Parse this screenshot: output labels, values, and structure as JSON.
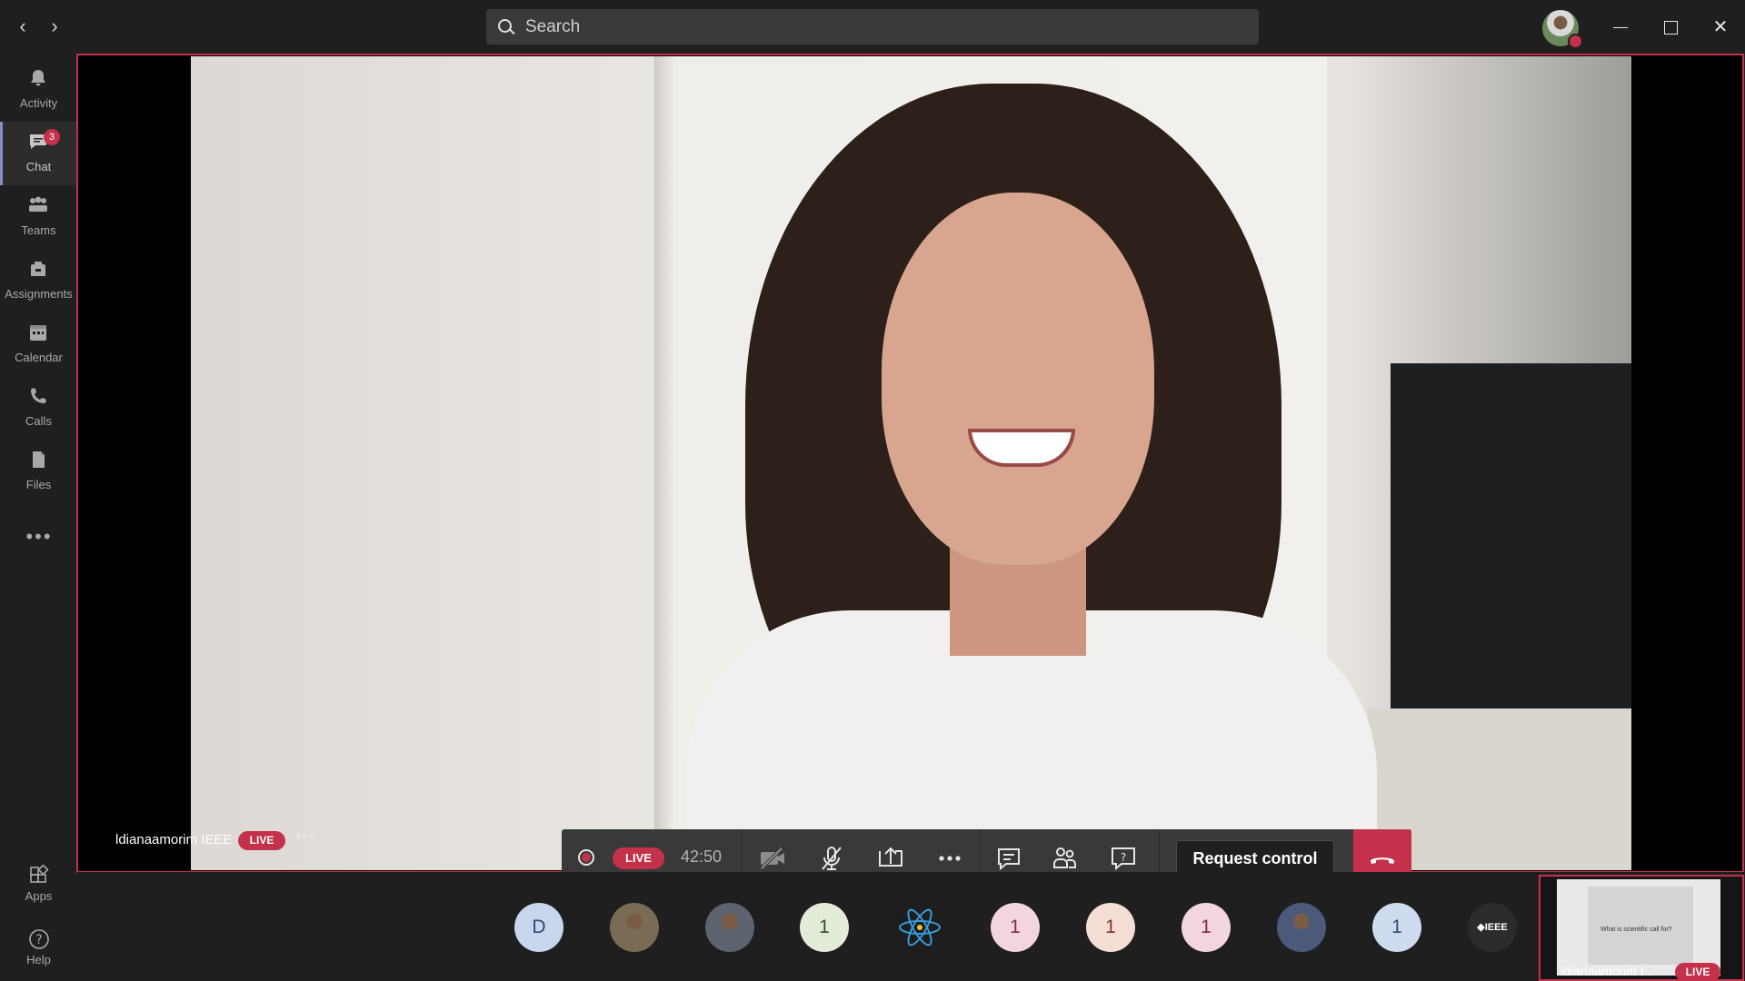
{
  "search": {
    "placeholder": "Search"
  },
  "rail": {
    "items": [
      {
        "label": "Activity",
        "icon": "bell-icon"
      },
      {
        "label": "Chat",
        "icon": "chat-icon",
        "badge": "3",
        "active": true
      },
      {
        "label": "Teams",
        "icon": "teams-icon"
      },
      {
        "label": "Assignments",
        "icon": "backpack-icon"
      },
      {
        "label": "Calendar",
        "icon": "calendar-icon"
      },
      {
        "label": "Calls",
        "icon": "phone-icon"
      },
      {
        "label": "Files",
        "icon": "file-icon"
      }
    ],
    "more": "•••",
    "apps": "Apps",
    "help": "Help"
  },
  "meeting": {
    "presenter_name": "ldianaamorim IEEE",
    "live_label": "LIVE",
    "presenter_more": "•••",
    "timer": "42:50",
    "request_control": "Request control"
  },
  "participants": [
    {
      "initial": "D",
      "bg": "#c7d6ec",
      "fg": "#2f4a78"
    },
    {
      "initial": "",
      "bg": "#7a6b55",
      "fg": "#fff",
      "photo": true
    },
    {
      "initial": "",
      "bg": "#5d6470",
      "fg": "#fff",
      "photo": true
    },
    {
      "initial": "1",
      "bg": "#e2ecd9",
      "fg": "#3a4f2b"
    },
    {
      "initial": "",
      "bg": "#1d1d1d",
      "fg": "#fff",
      "logo": true
    },
    {
      "initial": "1",
      "bg": "#f2d5df",
      "fg": "#7b2d47"
    },
    {
      "initial": "1",
      "bg": "#f4ddd4",
      "fg": "#7a3a25"
    },
    {
      "initial": "1",
      "bg": "#f2d5df",
      "fg": "#7b2d47"
    },
    {
      "initial": "",
      "bg": "#4b5a7a",
      "fg": "#fff",
      "photo": true
    },
    {
      "initial": "1",
      "bg": "#cfdcef",
      "fg": "#2f4a78"
    },
    {
      "initial": "◆IEEE",
      "bg": "#2b2b2b",
      "fg": "#fff"
    }
  ],
  "thumbnail": {
    "name": "ldianaamorim I...",
    "live_label": "LIVE",
    "slide_text": "What is scientific call for?"
  },
  "colors": {
    "accent": "#c4314b",
    "rail_active": "#8b8cc7"
  }
}
